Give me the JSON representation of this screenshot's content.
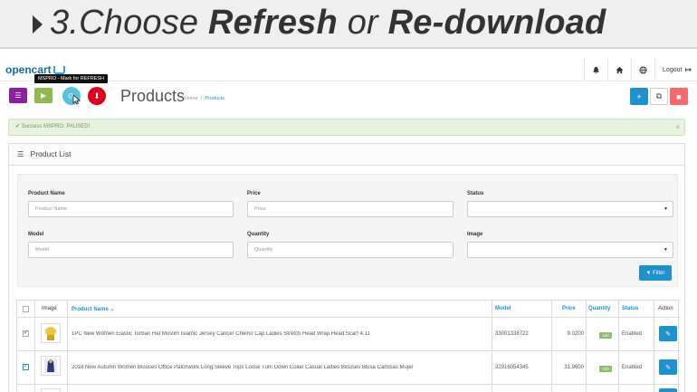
{
  "banner": {
    "step_prefix": "3.Choose ",
    "word1": "Refresh",
    "middle": " or ",
    "word2": "Re-download"
  },
  "header": {
    "logo_text": "opencart",
    "logout_label": "Logout"
  },
  "tooltip": {
    "text": "MSPRO - Mark for REFRESH"
  },
  "page": {
    "title": "Products",
    "breadcrumb": [
      "Home",
      "Products"
    ]
  },
  "alert": {
    "text": "Success MSPRO: PAUSED!"
  },
  "panel": {
    "title": "Product List"
  },
  "filter": {
    "product_name_label": "Product Name",
    "product_name_placeholder": "Product Name",
    "price_label": "Price",
    "price_placeholder": "Price",
    "status_label": "Status",
    "model_label": "Model",
    "model_placeholder": "Model",
    "quantity_label": "Quantity",
    "quantity_placeholder": "Quantity",
    "image_label": "Image",
    "filter_button": "Filter"
  },
  "table": {
    "headers": {
      "image": "Image",
      "product_name": "Product Name",
      "model": "Model",
      "price": "Price",
      "quantity": "Quantity",
      "status": "Status",
      "action": "Action"
    },
    "rows": [
      {
        "checked": true,
        "name": "1PC New Women Elastic Turban Hat Muslim Islamic Jersey Cancer Chemo Cap Ladies Stretch Head Wrap Head Scarf 4.11",
        "model": "33001338722",
        "price": "9.0200",
        "quantity": "100",
        "status": "Enabled"
      },
      {
        "checked": true,
        "name": "2018 New Autumn Women Blouses Office Patchwork Long Sleeve Tops Loose Turn Down Collar Casual Ladies Blouses Blusa Camisas Mujer",
        "model": "32916054345",
        "price": "31.9600",
        "quantity": "100",
        "status": "Enabled"
      }
    ]
  },
  "colors": {
    "primary": "#1e91cf",
    "purple": "#8e1fa3",
    "green": "#8fbb4d",
    "light_blue": "#5bc0de",
    "red": "#e0001b",
    "pink": "#f56b6b"
  }
}
